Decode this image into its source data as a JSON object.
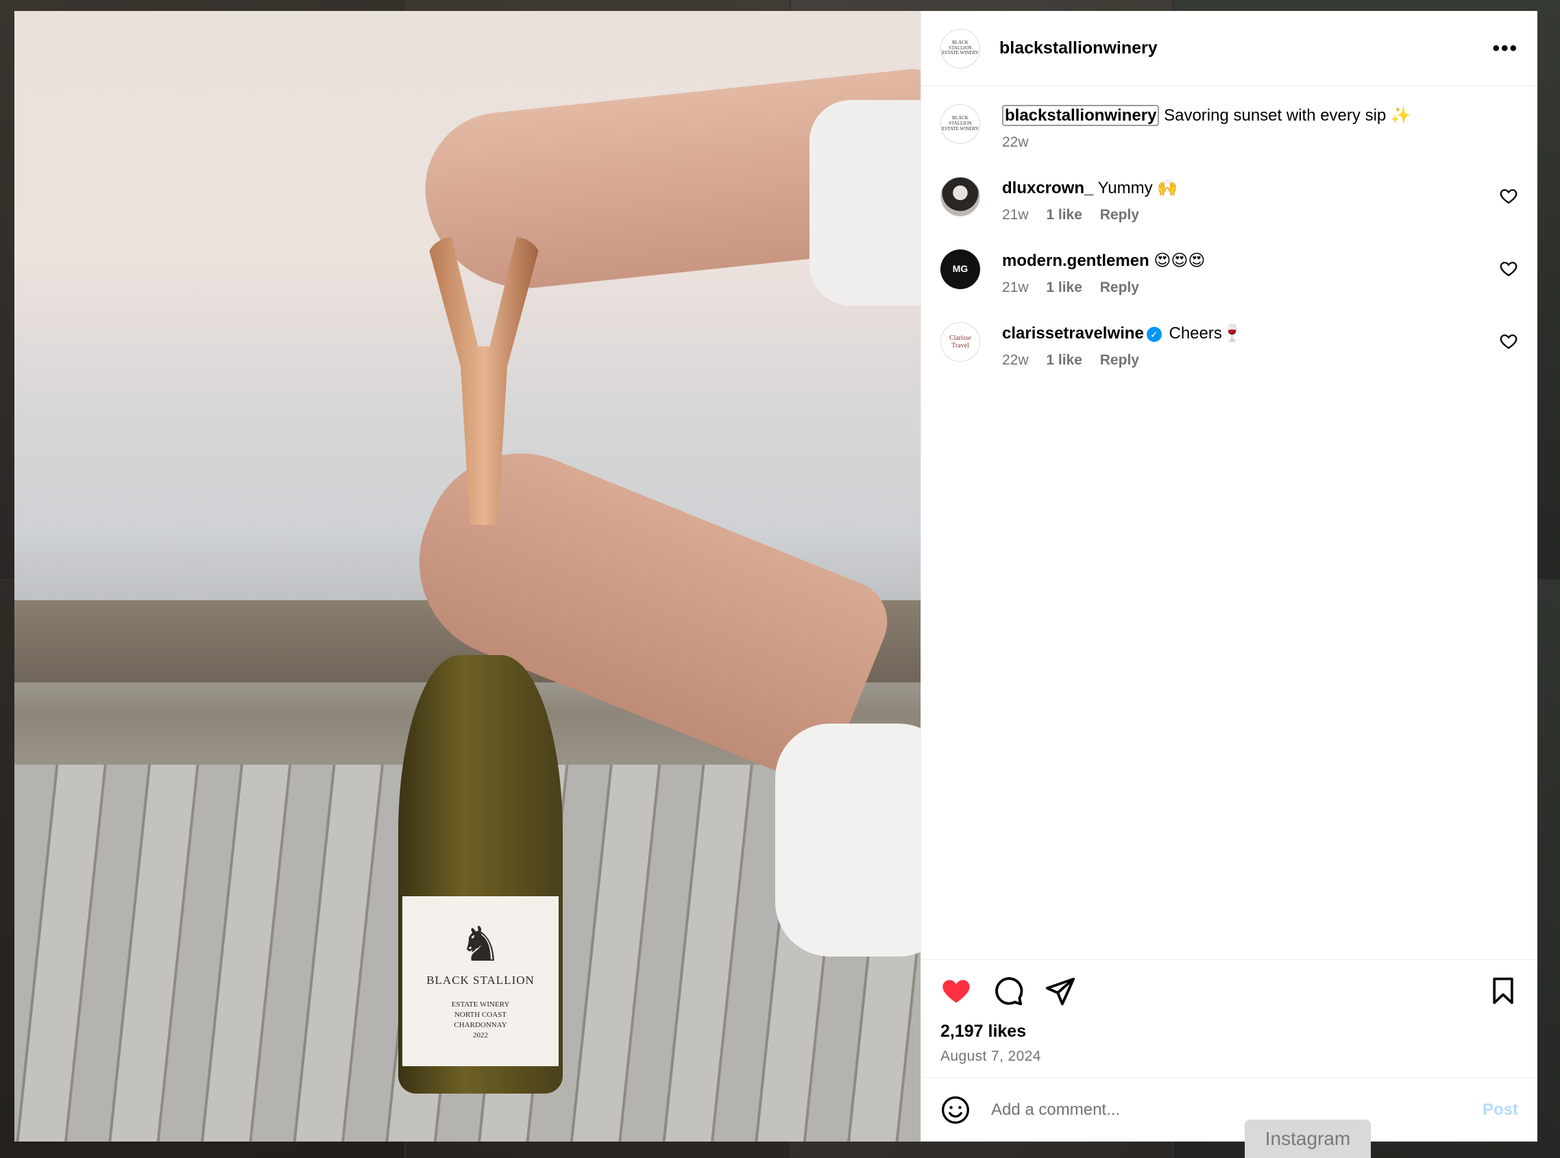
{
  "post": {
    "username": "blackstallionwinery",
    "avatar_text": "BLACK STALLION ESTATE WINERY",
    "more_icon": "more-horizontal-icon",
    "image_label": {
      "brand": "BLACK STALLION",
      "sub1": "ESTATE WINERY",
      "sub2": "NORTH COAST",
      "sub3": "CHARDONNAY",
      "sub4": "2022"
    }
  },
  "caption": {
    "username": "blackstallionwinery",
    "text": "Savoring sunset with every sip ✨",
    "time": "22w"
  },
  "comments": [
    {
      "username": "dluxcrown_",
      "text": "Yummy 🙌",
      "time": "21w",
      "likes": "1 like",
      "reply": "Reply"
    },
    {
      "username": "modern.gentlemen",
      "avatar_text": "MG",
      "text": "😍😍😍",
      "time": "21w",
      "likes": "1 like",
      "reply": "Reply"
    },
    {
      "username": "clarissetravelwine",
      "avatar_text": "Clarisse Travel",
      "text": "Cheers🍷",
      "time": "22w",
      "likes": "1 like",
      "reply": "Reply",
      "verified": true
    }
  ],
  "actions": {
    "likes": "2,197 likes",
    "date": "August 7, 2024",
    "liked_color": "#ff3040"
  },
  "composer": {
    "placeholder": "Add a comment...",
    "post_label": "Post"
  },
  "toast": "Instagram"
}
